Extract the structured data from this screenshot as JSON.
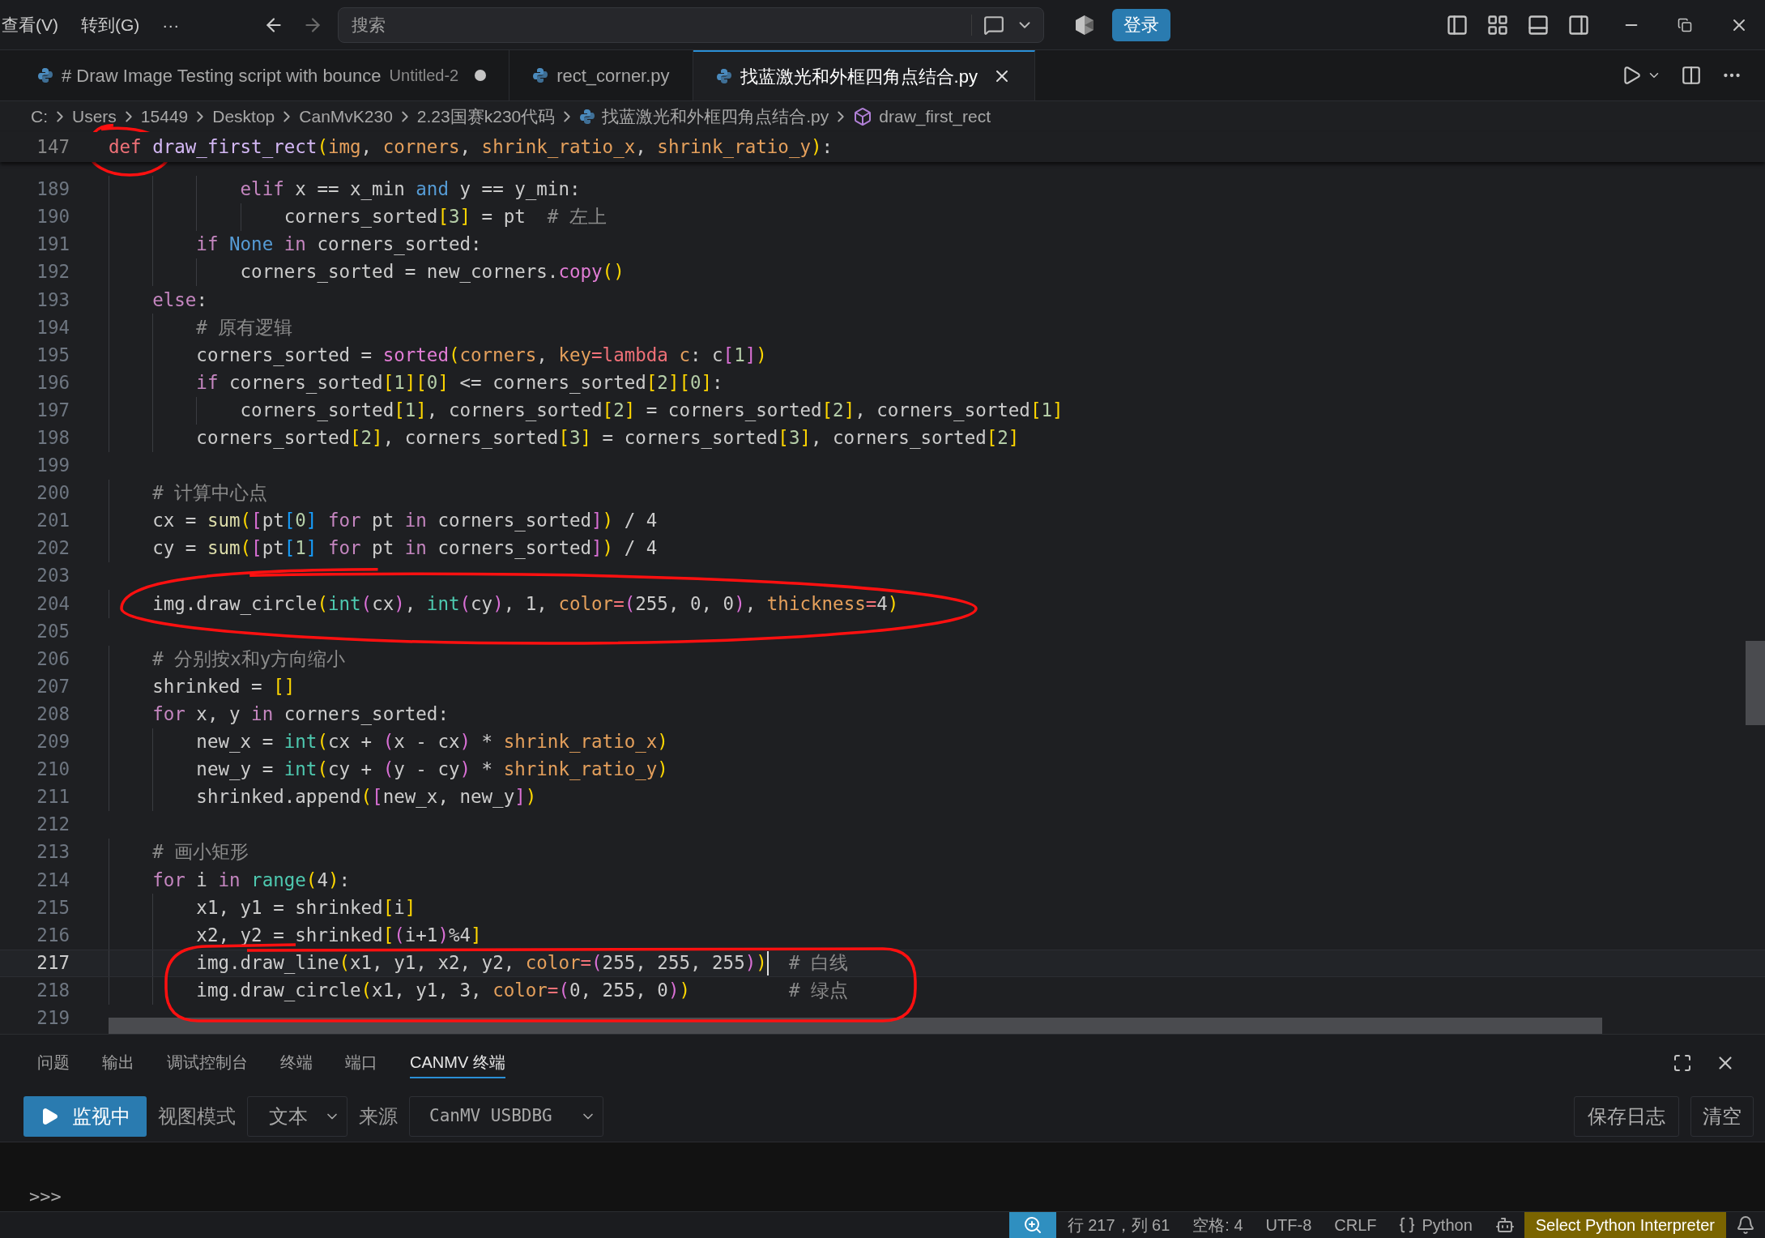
{
  "menu": [
    {
      "label": "查看(V)"
    },
    {
      "label": "转到(G)"
    },
    {
      "label": "···"
    }
  ],
  "search": {
    "placeholder": "搜索"
  },
  "login_button": {
    "label": "登录"
  },
  "tabs": [
    {
      "label": "# Draw Image Testing script with bounce",
      "description": "Untitled-2",
      "dirty": true,
      "selected": false
    },
    {
      "label": "rect_corner.py",
      "dirty": false,
      "selected": false
    },
    {
      "label": "找蓝激光和外框四角点结合.py",
      "dirty": false,
      "selected": true
    }
  ],
  "breadcrumb": [
    {
      "label": "C:",
      "kind": "folder"
    },
    {
      "label": "Users",
      "kind": "folder"
    },
    {
      "label": "15449",
      "kind": "folder"
    },
    {
      "label": "Desktop",
      "kind": "folder"
    },
    {
      "label": "CanMvK230",
      "kind": "folder"
    },
    {
      "label": "2.23国赛k230代码",
      "kind": "folder"
    },
    {
      "label": "找蓝激光和外框四角点结合.py",
      "kind": "file"
    },
    {
      "label": "draw_first_rect",
      "kind": "symbol"
    }
  ],
  "sticky_line": {
    "n": "147",
    "tokens": [
      {
        "kind": "kd",
        "text": "def "
      },
      {
        "kind": "fn",
        "text": "draw_first_rect"
      },
      {
        "kind": "b1",
        "text": "("
      },
      {
        "kind": "pa",
        "text": "img"
      },
      {
        "kind": "p",
        "text": ", "
      },
      {
        "kind": "pa",
        "text": "corners"
      },
      {
        "kind": "p",
        "text": ", "
      },
      {
        "kind": "pa",
        "text": "shrink_ratio_x"
      },
      {
        "kind": "p",
        "text": ", "
      },
      {
        "kind": "pa",
        "text": "shrink_ratio_y"
      },
      {
        "kind": "b1",
        "text": ")"
      },
      {
        "kind": "p",
        "text": ":"
      }
    ]
  },
  "lines": [
    {
      "n": "189",
      "current": false,
      "tokens": [
        {
          "kind": "kw",
          "text": "            elif"
        },
        {
          "kind": "p",
          "text": " x == x_min "
        },
        {
          "kind": "kwb",
          "text": "and"
        },
        {
          "kind": "p",
          "text": " y == y_min:"
        }
      ]
    },
    {
      "n": "190",
      "current": false,
      "tokens": [
        {
          "kind": "p",
          "text": "                corners_sorted"
        },
        {
          "kind": "b1",
          "text": "["
        },
        {
          "kind": "num",
          "text": "3"
        },
        {
          "kind": "b1",
          "text": "]"
        },
        {
          "kind": "p",
          "text": " = pt  "
        },
        {
          "kind": "cm",
          "text": "# 左上"
        }
      ]
    },
    {
      "n": "191",
      "current": false,
      "tokens": [
        {
          "kind": "kw",
          "text": "        if"
        },
        {
          "kind": "kwb",
          "text": " None"
        },
        {
          "kind": "kw",
          "text": " in"
        },
        {
          "kind": "p",
          "text": " corners_sorted:"
        }
      ]
    },
    {
      "n": "192",
      "current": false,
      "tokens": [
        {
          "kind": "p",
          "text": "            corners_sorted = new_corners."
        },
        {
          "kind": "m",
          "text": "copy"
        },
        {
          "kind": "b1",
          "text": "("
        },
        {
          "kind": "b1",
          "text": ")"
        }
      ]
    },
    {
      "n": "193",
      "current": false,
      "tokens": [
        {
          "kind": "kw",
          "text": "    else"
        },
        {
          "kind": "p",
          "text": ":"
        }
      ]
    },
    {
      "n": "194",
      "current": false,
      "tokens": [
        {
          "kind": "cm",
          "text": "        # 原有逻辑"
        }
      ]
    },
    {
      "n": "195",
      "current": false,
      "tokens": [
        {
          "kind": "p",
          "text": "        corners_sorted = "
        },
        {
          "kind": "m",
          "text": "sorted"
        },
        {
          "kind": "b1",
          "text": "("
        },
        {
          "kind": "pa",
          "text": "corners"
        },
        {
          "kind": "p",
          "text": ", "
        },
        {
          "kind": "pa",
          "text": "key"
        },
        {
          "kind": "kd",
          "text": "="
        },
        {
          "kind": "kd",
          "text": "lambda "
        },
        {
          "kind": "pa",
          "text": "c"
        },
        {
          "kind": "p",
          "text": ": c"
        },
        {
          "kind": "b2",
          "text": "["
        },
        {
          "kind": "num",
          "text": "1"
        },
        {
          "kind": "b2",
          "text": "]"
        },
        {
          "kind": "b1",
          "text": ")"
        }
      ]
    },
    {
      "n": "196",
      "current": false,
      "tokens": [
        {
          "kind": "kw",
          "text": "        if"
        },
        {
          "kind": "p",
          "text": " corners_sorted"
        },
        {
          "kind": "b1",
          "text": "["
        },
        {
          "kind": "num",
          "text": "1"
        },
        {
          "kind": "b1",
          "text": "]"
        },
        {
          "kind": "b1",
          "text": "["
        },
        {
          "kind": "num",
          "text": "0"
        },
        {
          "kind": "b1",
          "text": "]"
        },
        {
          "kind": "p",
          "text": " <= corners_sorted"
        },
        {
          "kind": "b1",
          "text": "["
        },
        {
          "kind": "num",
          "text": "2"
        },
        {
          "kind": "b1",
          "text": "]"
        },
        {
          "kind": "b1",
          "text": "["
        },
        {
          "kind": "num",
          "text": "0"
        },
        {
          "kind": "b1",
          "text": "]"
        },
        {
          "kind": "p",
          "text": ":"
        }
      ]
    },
    {
      "n": "197",
      "current": false,
      "tokens": [
        {
          "kind": "p",
          "text": "            corners_sorted"
        },
        {
          "kind": "b1",
          "text": "["
        },
        {
          "kind": "num",
          "text": "1"
        },
        {
          "kind": "b1",
          "text": "]"
        },
        {
          "kind": "p",
          "text": ", corners_sorted"
        },
        {
          "kind": "b1",
          "text": "["
        },
        {
          "kind": "num",
          "text": "2"
        },
        {
          "kind": "b1",
          "text": "]"
        },
        {
          "kind": "p",
          "text": " = corners_sorted"
        },
        {
          "kind": "b1",
          "text": "["
        },
        {
          "kind": "num",
          "text": "2"
        },
        {
          "kind": "b1",
          "text": "]"
        },
        {
          "kind": "p",
          "text": ", corners_sorted"
        },
        {
          "kind": "b1",
          "text": "["
        },
        {
          "kind": "num",
          "text": "1"
        },
        {
          "kind": "b1",
          "text": "]"
        }
      ]
    },
    {
      "n": "198",
      "current": false,
      "tokens": [
        {
          "kind": "p",
          "text": "        corners_sorted"
        },
        {
          "kind": "b1",
          "text": "["
        },
        {
          "kind": "num",
          "text": "2"
        },
        {
          "kind": "b1",
          "text": "]"
        },
        {
          "kind": "p",
          "text": ", corners_sorted"
        },
        {
          "kind": "b1",
          "text": "["
        },
        {
          "kind": "num",
          "text": "3"
        },
        {
          "kind": "b1",
          "text": "]"
        },
        {
          "kind": "p",
          "text": " = corners_sorted"
        },
        {
          "kind": "b1",
          "text": "["
        },
        {
          "kind": "num",
          "text": "3"
        },
        {
          "kind": "b1",
          "text": "]"
        },
        {
          "kind": "p",
          "text": ", corners_sorted"
        },
        {
          "kind": "b1",
          "text": "["
        },
        {
          "kind": "num",
          "text": "2"
        },
        {
          "kind": "b1",
          "text": "]"
        }
      ]
    },
    {
      "n": "199",
      "current": false
    },
    {
      "n": "200",
      "current": false,
      "tokens": [
        {
          "kind": "cm",
          "text": "    # 计算中心点"
        }
      ]
    },
    {
      "n": "201",
      "current": false,
      "tokens": [
        {
          "kind": "p",
          "text": "    cx = "
        },
        {
          "kind": "fn2",
          "text": "sum"
        },
        {
          "kind": "b1",
          "text": "("
        },
        {
          "kind": "b2",
          "text": "["
        },
        {
          "kind": "p",
          "text": "pt"
        },
        {
          "kind": "b3",
          "text": "["
        },
        {
          "kind": "num",
          "text": "0"
        },
        {
          "kind": "b3",
          "text": "]"
        },
        {
          "kind": "kw",
          "text": " for"
        },
        {
          "kind": "p",
          "text": " pt "
        },
        {
          "kind": "kw",
          "text": "in"
        },
        {
          "kind": "p",
          "text": " corners_sorted"
        },
        {
          "kind": "b2",
          "text": "]"
        },
        {
          "kind": "b1",
          "text": ")"
        },
        {
          "kind": "p",
          "text": " / 4"
        }
      ]
    },
    {
      "n": "202",
      "current": false,
      "tokens": [
        {
          "kind": "p",
          "text": "    cy = "
        },
        {
          "kind": "fn2",
          "text": "sum"
        },
        {
          "kind": "b1",
          "text": "("
        },
        {
          "kind": "b2",
          "text": "["
        },
        {
          "kind": "p",
          "text": "pt"
        },
        {
          "kind": "b3",
          "text": "["
        },
        {
          "kind": "num",
          "text": "1"
        },
        {
          "kind": "b3",
          "text": "]"
        },
        {
          "kind": "kw",
          "text": " for"
        },
        {
          "kind": "p",
          "text": " pt "
        },
        {
          "kind": "kw",
          "text": "in"
        },
        {
          "kind": "p",
          "text": " corners_sorted"
        },
        {
          "kind": "b2",
          "text": "]"
        },
        {
          "kind": "b1",
          "text": ")"
        },
        {
          "kind": "p",
          "text": " / 4"
        }
      ]
    },
    {
      "n": "203",
      "current": false
    },
    {
      "n": "204",
      "current": false,
      "tokens": [
        {
          "kind": "p",
          "text": "    img.draw_circle"
        },
        {
          "kind": "b1",
          "text": "("
        },
        {
          "kind": "bi",
          "text": "int"
        },
        {
          "kind": "b2",
          "text": "("
        },
        {
          "kind": "p",
          "text": "cx"
        },
        {
          "kind": "b2",
          "text": ")"
        },
        {
          "kind": "p",
          "text": ", "
        },
        {
          "kind": "bi",
          "text": "int"
        },
        {
          "kind": "b2",
          "text": "("
        },
        {
          "kind": "p",
          "text": "cy"
        },
        {
          "kind": "b2",
          "text": ")"
        },
        {
          "kind": "p",
          "text": ", 1, "
        },
        {
          "kind": "pa",
          "text": "color"
        },
        {
          "kind": "kd",
          "text": "="
        },
        {
          "kind": "b2",
          "text": "("
        },
        {
          "kind": "p",
          "text": "255, 0, 0"
        },
        {
          "kind": "b2",
          "text": ")"
        },
        {
          "kind": "p",
          "text": ", "
        },
        {
          "kind": "pa",
          "text": "thickness"
        },
        {
          "kind": "kd",
          "text": "="
        },
        {
          "kind": "p",
          "text": "4"
        },
        {
          "kind": "b1",
          "text": ")"
        }
      ]
    },
    {
      "n": "205",
      "current": false
    },
    {
      "n": "206",
      "current": false,
      "tokens": [
        {
          "kind": "cm",
          "text": "    # 分别按x和y方向缩小"
        }
      ]
    },
    {
      "n": "207",
      "current": false,
      "tokens": [
        {
          "kind": "p",
          "text": "    shrinked = "
        },
        {
          "kind": "b1",
          "text": "["
        },
        {
          "kind": "b1",
          "text": "]"
        }
      ]
    },
    {
      "n": "208",
      "current": false,
      "tokens": [
        {
          "kind": "kw",
          "text": "    for"
        },
        {
          "kind": "p",
          "text": " x, y "
        },
        {
          "kind": "kw",
          "text": "in"
        },
        {
          "kind": "p",
          "text": " corners_sorted:"
        }
      ]
    },
    {
      "n": "209",
      "current": false,
      "tokens": [
        {
          "kind": "p",
          "text": "        new_x = "
        },
        {
          "kind": "bi",
          "text": "int"
        },
        {
          "kind": "b1",
          "text": "("
        },
        {
          "kind": "p",
          "text": "cx + "
        },
        {
          "kind": "b2",
          "text": "("
        },
        {
          "kind": "p",
          "text": "x - cx"
        },
        {
          "kind": "b2",
          "text": ")"
        },
        {
          "kind": "p",
          "text": " * "
        },
        {
          "kind": "pa",
          "text": "shrink_ratio_x"
        },
        {
          "kind": "b1",
          "text": ")"
        }
      ]
    },
    {
      "n": "210",
      "current": false,
      "tokens": [
        {
          "kind": "p",
          "text": "        new_y = "
        },
        {
          "kind": "bi",
          "text": "int"
        },
        {
          "kind": "b1",
          "text": "("
        },
        {
          "kind": "p",
          "text": "cy + "
        },
        {
          "kind": "b2",
          "text": "("
        },
        {
          "kind": "p",
          "text": "y - cy"
        },
        {
          "kind": "b2",
          "text": ")"
        },
        {
          "kind": "p",
          "text": " * "
        },
        {
          "kind": "pa",
          "text": "shrink_ratio_y"
        },
        {
          "kind": "b1",
          "text": ")"
        }
      ]
    },
    {
      "n": "211",
      "current": false,
      "tokens": [
        {
          "kind": "p",
          "text": "        shrinked.append"
        },
        {
          "kind": "b1",
          "text": "("
        },
        {
          "kind": "b2",
          "text": "["
        },
        {
          "kind": "p",
          "text": "new_x, new_y"
        },
        {
          "kind": "b2",
          "text": "]"
        },
        {
          "kind": "b1",
          "text": ")"
        }
      ]
    },
    {
      "n": "212",
      "current": false
    },
    {
      "n": "213",
      "current": false,
      "tokens": [
        {
          "kind": "cm",
          "text": "    # 画小矩形"
        }
      ]
    },
    {
      "n": "214",
      "current": false,
      "tokens": [
        {
          "kind": "kw",
          "text": "    for"
        },
        {
          "kind": "p",
          "text": " i "
        },
        {
          "kind": "kw",
          "text": "in"
        },
        {
          "kind": "bi",
          "text": " range"
        },
        {
          "kind": "b1",
          "text": "("
        },
        {
          "kind": "p",
          "text": "4"
        },
        {
          "kind": "b1",
          "text": ")"
        },
        {
          "kind": "p",
          "text": ":"
        }
      ]
    },
    {
      "n": "215",
      "current": false,
      "tokens": [
        {
          "kind": "p",
          "text": "        x1, y1 = shrinked"
        },
        {
          "kind": "b1",
          "text": "["
        },
        {
          "kind": "p",
          "text": "i"
        },
        {
          "kind": "b1",
          "text": "]"
        }
      ]
    },
    {
      "n": "216",
      "current": false,
      "tokens": [
        {
          "kind": "p",
          "text": "        x2, y2 = shrinked"
        },
        {
          "kind": "b1",
          "text": "["
        },
        {
          "kind": "b2",
          "text": "("
        },
        {
          "kind": "p",
          "text": "i+1"
        },
        {
          "kind": "b2",
          "text": ")"
        },
        {
          "kind": "p",
          "text": "%4"
        },
        {
          "kind": "b1",
          "text": "]"
        }
      ]
    },
    {
      "n": "217",
      "current": true,
      "tokens": [
        {
          "kind": "p",
          "text": "        img.draw_line"
        },
        {
          "kind": "b1",
          "text": "("
        },
        {
          "kind": "p",
          "text": "x1, y1, x2, y2, "
        },
        {
          "kind": "pa",
          "text": "color"
        },
        {
          "kind": "kd",
          "text": "="
        },
        {
          "kind": "b2",
          "text": "("
        },
        {
          "kind": "p",
          "text": "255, 255, 255"
        },
        {
          "kind": "b2",
          "text": ")"
        },
        {
          "kind": "b1",
          "text": ")"
        },
        {
          "kind": "cm",
          "text": "  # 白线"
        }
      ]
    },
    {
      "n": "218",
      "current": false,
      "tokens": [
        {
          "kind": "p",
          "text": "        img.draw_circle"
        },
        {
          "kind": "b1",
          "text": "("
        },
        {
          "kind": "p",
          "text": "x1, y1, 3, "
        },
        {
          "kind": "pa",
          "text": "color"
        },
        {
          "kind": "kd",
          "text": "="
        },
        {
          "kind": "b2",
          "text": "("
        },
        {
          "kind": "p",
          "text": "0, 255, 0"
        },
        {
          "kind": "b2",
          "text": ")"
        },
        {
          "kind": "b1",
          "text": ")"
        },
        {
          "kind": "cm",
          "text": "         # 绿点"
        }
      ]
    },
    {
      "n": "219",
      "current": false
    }
  ],
  "panel": {
    "tabs": [
      {
        "label": "问题",
        "selected": false
      },
      {
        "label": "输出",
        "selected": false
      },
      {
        "label": "调试控制台",
        "selected": false
      },
      {
        "label": "终端",
        "selected": false
      },
      {
        "label": "端口",
        "selected": false
      },
      {
        "label": "CANMV 终端",
        "selected": true
      }
    ],
    "monitor_button": {
      "label": "监视中"
    },
    "view_mode_label": "视图模式",
    "view_mode_select": {
      "value": "文本"
    },
    "source_label": "来源",
    "source_select": {
      "value": "CanMV USBDBG"
    },
    "save_log_button": {
      "label": "保存日志"
    },
    "clear_button": {
      "label": "清空"
    },
    "prompt": ">>>"
  },
  "status_bar": [
    {
      "label": "行 217，列 61",
      "kind": "text"
    },
    {
      "label": "空格: 4",
      "kind": "text"
    },
    {
      "label": "UTF-8",
      "kind": "text"
    },
    {
      "label": "CRLF",
      "kind": "text"
    },
    {
      "label": "Python",
      "kind": "language"
    },
    {
      "label": "Select Python Interpreter",
      "kind": "warning"
    }
  ]
}
